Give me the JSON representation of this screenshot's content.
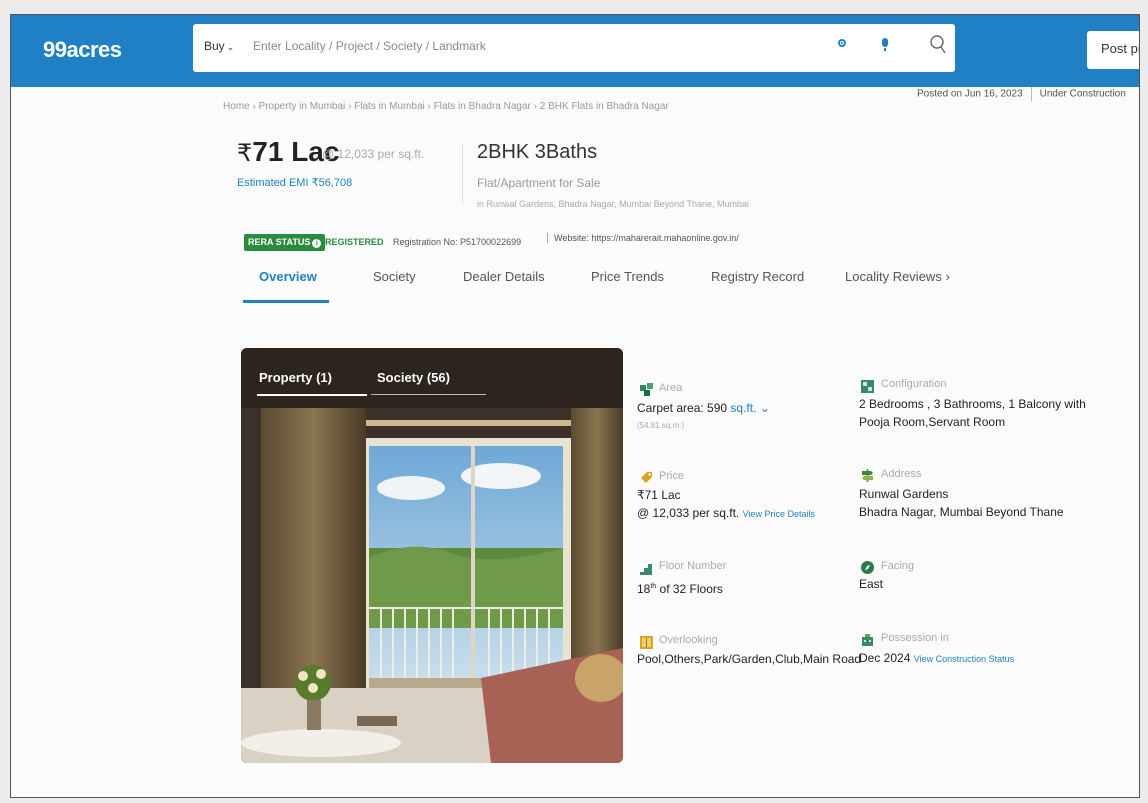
{
  "header": {
    "logo": "99acres",
    "buy_label": "Buy",
    "search_placeholder": "Enter Locality / Project / Society / Landmark",
    "post_label": "Post pr"
  },
  "breadcrumb": "Home › Property in Mumbai › Flats in Mumbai › Flats in Bhadra Nagar › 2 BHK Flats in Bhadra Nagar",
  "meta": {
    "posted": "Posted on Jun 16, 2023",
    "status": "Under Construction"
  },
  "listing": {
    "price_symbol": "₹",
    "price": "71 Lac",
    "per_sqft": "@ 12,033 per sq.ft.",
    "emi": "Estimated EMI ₹56,708",
    "config": "2BHK 3Baths",
    "type": "Flat/Apartment for Sale",
    "location": "in Runwal Gardens, Bhadra Nagar, Mumbai Beyond Thane, Mumbai"
  },
  "rera": {
    "badge": "RERA STATUS",
    "status": "REGISTERED",
    "reg_no": "Registration No: P51700022699",
    "website": "Website: https://maharerait.mahaonline.gov.in/"
  },
  "tabs": [
    "Overview",
    "Society",
    "Dealer Details",
    "Price Trends",
    "Registry Record",
    "Locality Reviews"
  ],
  "photo_tabs": [
    "Property (1)",
    "Society (56)"
  ],
  "details": {
    "area": {
      "label": "Area",
      "value": "Carpet area: 590",
      "unit": "sq.ft.",
      "sub": "(54.81 sq.m.)"
    },
    "configuration": {
      "label": "Configuration",
      "line1": "2 Bedrooms , 3 Bathrooms, 1 Balcony with",
      "line2": "Pooja Room,Servant Room"
    },
    "price": {
      "label": "Price",
      "line1": "₹71 Lac",
      "line2": "@ 12,033 per sq.ft.",
      "link": "View Price Details"
    },
    "address": {
      "label": "Address",
      "line1": "Runwal Gardens",
      "line2": "Bhadra Nagar, Mumbai Beyond Thane"
    },
    "floor": {
      "label": "Floor Number",
      "num": "18",
      "sup": "th",
      "rest": " of 32 Floors"
    },
    "facing": {
      "label": "Facing",
      "value": "East"
    },
    "overlooking": {
      "label": "Overlooking",
      "value": "Pool,Others,Park/Garden,Club,Main Road"
    },
    "possession": {
      "label": "Possession in",
      "value": "Dec 2024",
      "link": "View Construction Status"
    }
  },
  "colors": {
    "brand": "#1f80c6",
    "rera": "#2a8a3e"
  }
}
